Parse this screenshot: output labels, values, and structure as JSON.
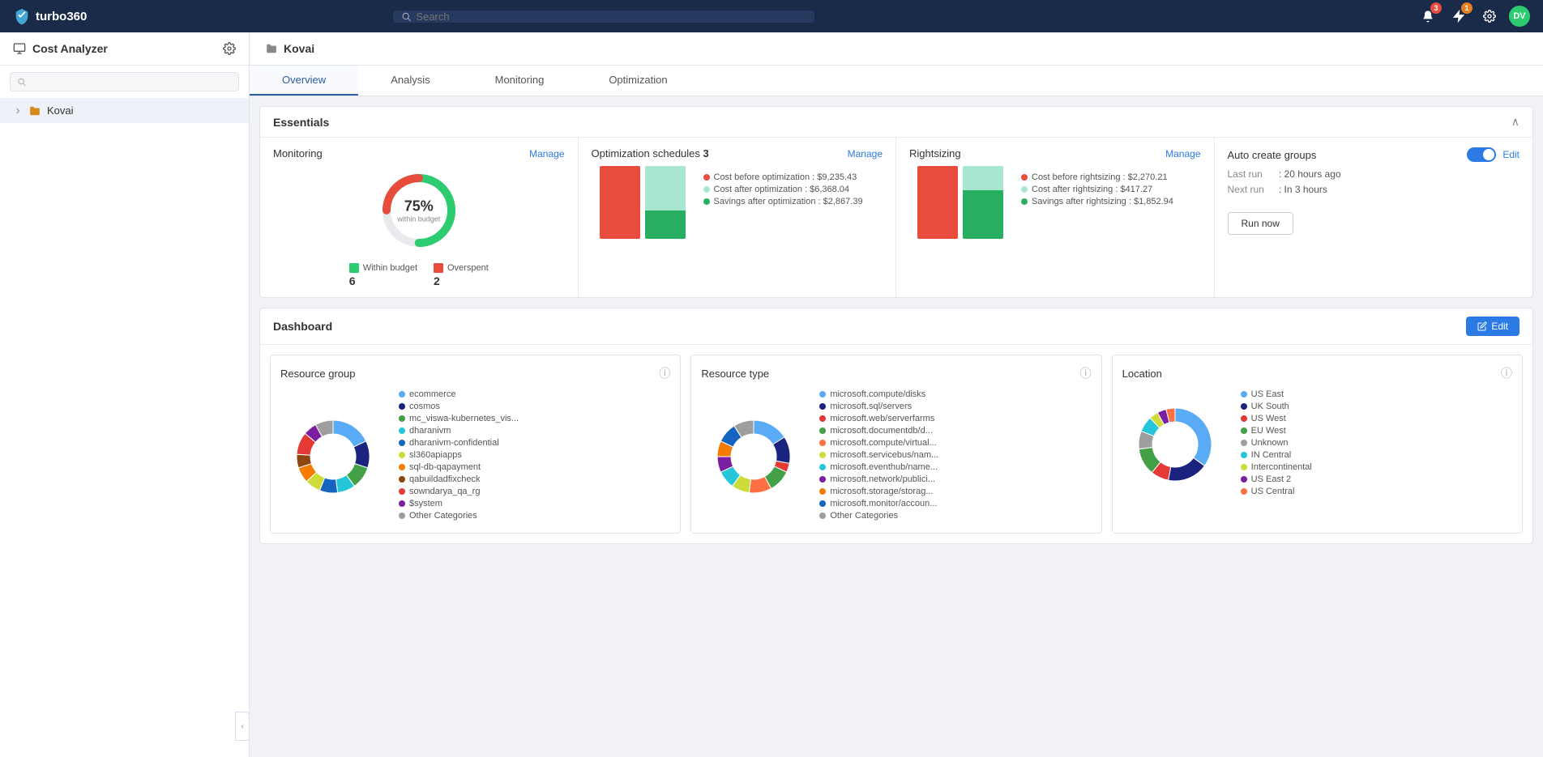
{
  "app": {
    "name": "turbo360",
    "logo_text": "turbo360"
  },
  "topnav": {
    "search_placeholder": "Search",
    "notifications_count": "3",
    "alerts_count": "1",
    "user_initials": "DV"
  },
  "sidebar": {
    "title": "Cost Analyzer",
    "search_placeholder": "",
    "items": [
      {
        "label": "Kovai",
        "icon": "folder"
      }
    ]
  },
  "page": {
    "breadcrumb": "Kovai",
    "tabs": [
      "Overview",
      "Analysis",
      "Monitoring",
      "Optimization"
    ]
  },
  "essentials": {
    "title": "Essentials",
    "monitoring": {
      "label": "Monitoring",
      "manage_label": "Manage",
      "donut_pct": "75%",
      "donut_sub": "within budget",
      "within_budget_label": "Within budget",
      "within_budget_count": "6",
      "overspent_label": "Overspent",
      "overspent_count": "2"
    },
    "optimization": {
      "label": "Optimization schedules",
      "count": "3",
      "manage_label": "Manage",
      "cost_before_label": "Cost before optimization",
      "cost_before_value": "$9,235.43",
      "cost_after_label": "Cost after optimization",
      "cost_after_value": "$6,368.04",
      "savings_label": "Savings after optimization",
      "savings_value": "$2,867.39",
      "bar1_red": 90,
      "bar1_green": 0,
      "bar2_mint": 60,
      "bar2_green": 30
    },
    "rightsizing": {
      "label": "Rightsizing",
      "manage_label": "Manage",
      "cost_before_label": "Cost before rightsizing",
      "cost_before_value": "$2,270.21",
      "cost_after_label": "Cost after rightsizing",
      "cost_after_value": "$417.27",
      "savings_label": "Savings after rightsizing",
      "savings_value": "$1,852.94"
    },
    "auto_create": {
      "label": "Auto create groups",
      "edit_label": "Edit",
      "last_run_label": "Last run",
      "last_run_value": "20 hours ago",
      "next_run_label": "Next run",
      "next_run_value": "In 3 hours",
      "run_now_label": "Run now"
    }
  },
  "dashboard": {
    "title": "Dashboard",
    "edit_label": "Edit",
    "resource_group": {
      "title": "Resource group",
      "legend": [
        {
          "label": "ecommerce",
          "color": "#5aabf5"
        },
        {
          "label": "cosmos",
          "color": "#1a237e"
        },
        {
          "label": "mc_viswa-kubernetes_vis...",
          "color": "#43a047"
        },
        {
          "label": "dharanivm",
          "color": "#26c6da"
        },
        {
          "label": "dharanivm-confidential",
          "color": "#1565c0"
        },
        {
          "label": "sl360apiapps",
          "color": "#cddc39"
        },
        {
          "label": "sql-db-qapayment",
          "color": "#f57c00"
        },
        {
          "label": "qabuildadfixcheck",
          "color": "#8d4512"
        },
        {
          "label": "sowndarya_qa_rg",
          "color": "#e53935"
        },
        {
          "label": "$system",
          "color": "#7b1fa2"
        },
        {
          "label": "Other Categories",
          "color": "#9e9e9e"
        }
      ],
      "segments": [
        {
          "color": "#5aabf5",
          "pct": 18
        },
        {
          "color": "#1a237e",
          "pct": 12
        },
        {
          "color": "#43a047",
          "pct": 10
        },
        {
          "color": "#26c6da",
          "pct": 8
        },
        {
          "color": "#1565c0",
          "pct": 8
        },
        {
          "color": "#cddc39",
          "pct": 7
        },
        {
          "color": "#f57c00",
          "pct": 7
        },
        {
          "color": "#8d4512",
          "pct": 6
        },
        {
          "color": "#e53935",
          "pct": 10
        },
        {
          "color": "#7b1fa2",
          "pct": 6
        },
        {
          "color": "#9e9e9e",
          "pct": 8
        }
      ]
    },
    "resource_type": {
      "title": "Resource type",
      "legend": [
        {
          "label": "microsoft.compute/disks",
          "color": "#5aabf5"
        },
        {
          "label": "microsoft.sql/servers",
          "color": "#1a237e"
        },
        {
          "label": "microsoft.web/serverfarms",
          "color": "#e53935"
        },
        {
          "label": "microsoft.documentdb/d...",
          "color": "#43a047"
        },
        {
          "label": "microsoft.compute/virtual...",
          "color": "#ff7043"
        },
        {
          "label": "microsoft.servicebus/nam...",
          "color": "#cddc39"
        },
        {
          "label": "microsoft.eventhub/name...",
          "color": "#26c6da"
        },
        {
          "label": "microsoft.network/publici...",
          "color": "#7b1fa2"
        },
        {
          "label": "microsoft.storage/storag...",
          "color": "#f57c00"
        },
        {
          "label": "microsoft.monitor/accoun...",
          "color": "#1565c0"
        },
        {
          "label": "Other Categories",
          "color": "#9e9e9e"
        }
      ],
      "segments": [
        {
          "color": "#5aabf5",
          "pct": 16
        },
        {
          "color": "#1a237e",
          "pct": 12
        },
        {
          "color": "#e53935",
          "pct": 4
        },
        {
          "color": "#43a047",
          "pct": 10
        },
        {
          "color": "#ff7043",
          "pct": 10
        },
        {
          "color": "#cddc39",
          "pct": 8
        },
        {
          "color": "#26c6da",
          "pct": 8
        },
        {
          "color": "#7b1fa2",
          "pct": 7
        },
        {
          "color": "#f57c00",
          "pct": 7
        },
        {
          "color": "#1565c0",
          "pct": 9
        },
        {
          "color": "#9e9e9e",
          "pct": 9
        }
      ]
    },
    "location": {
      "title": "Location",
      "legend": [
        {
          "label": "US East",
          "color": "#5aabf5"
        },
        {
          "label": "UK South",
          "color": "#1a237e"
        },
        {
          "label": "US West",
          "color": "#e53935"
        },
        {
          "label": "EU West",
          "color": "#43a047"
        },
        {
          "label": "Unknown",
          "color": "#9e9e9e"
        },
        {
          "label": "IN Central",
          "color": "#26c6da"
        },
        {
          "label": "Intercontinental",
          "color": "#cddc39"
        },
        {
          "label": "US East 2",
          "color": "#7b1fa2"
        },
        {
          "label": "US Central",
          "color": "#ff7043"
        }
      ],
      "segments": [
        {
          "color": "#5aabf5",
          "pct": 35
        },
        {
          "color": "#1a237e",
          "pct": 18
        },
        {
          "color": "#e53935",
          "pct": 8
        },
        {
          "color": "#43a047",
          "pct": 12
        },
        {
          "color": "#9e9e9e",
          "pct": 8
        },
        {
          "color": "#26c6da",
          "pct": 7
        },
        {
          "color": "#cddc39",
          "pct": 4
        },
        {
          "color": "#7b1fa2",
          "pct": 4
        },
        {
          "color": "#ff7043",
          "pct": 4
        }
      ]
    }
  }
}
